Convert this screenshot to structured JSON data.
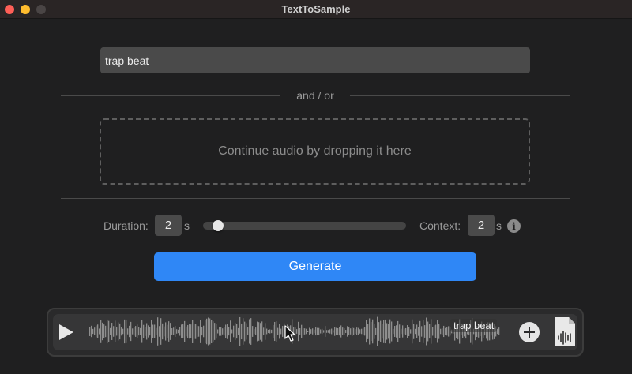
{
  "window": {
    "title": "TextToSample"
  },
  "prompt": {
    "value": "trap beat"
  },
  "separator": {
    "text": "and / or"
  },
  "dropzone": {
    "text": "Continue audio by dropping it here"
  },
  "duration": {
    "label": "Duration:",
    "value": "2",
    "unit": "s",
    "slider_fraction": 0.05
  },
  "context": {
    "label": "Context:",
    "value": "2",
    "unit": "s"
  },
  "generate": {
    "label": "Generate"
  },
  "player": {
    "sample_label": "trap beat"
  },
  "icons": {
    "close": "close-dot",
    "minimize": "minimize-dot",
    "zoom": "zoom-dot",
    "info": "info-icon",
    "play": "play-icon",
    "add": "plus-circle-icon",
    "file": "audio-file-icon"
  },
  "colors": {
    "accent": "#2f87f6",
    "background": "#1f1f20",
    "input": "#4a4a4a"
  }
}
